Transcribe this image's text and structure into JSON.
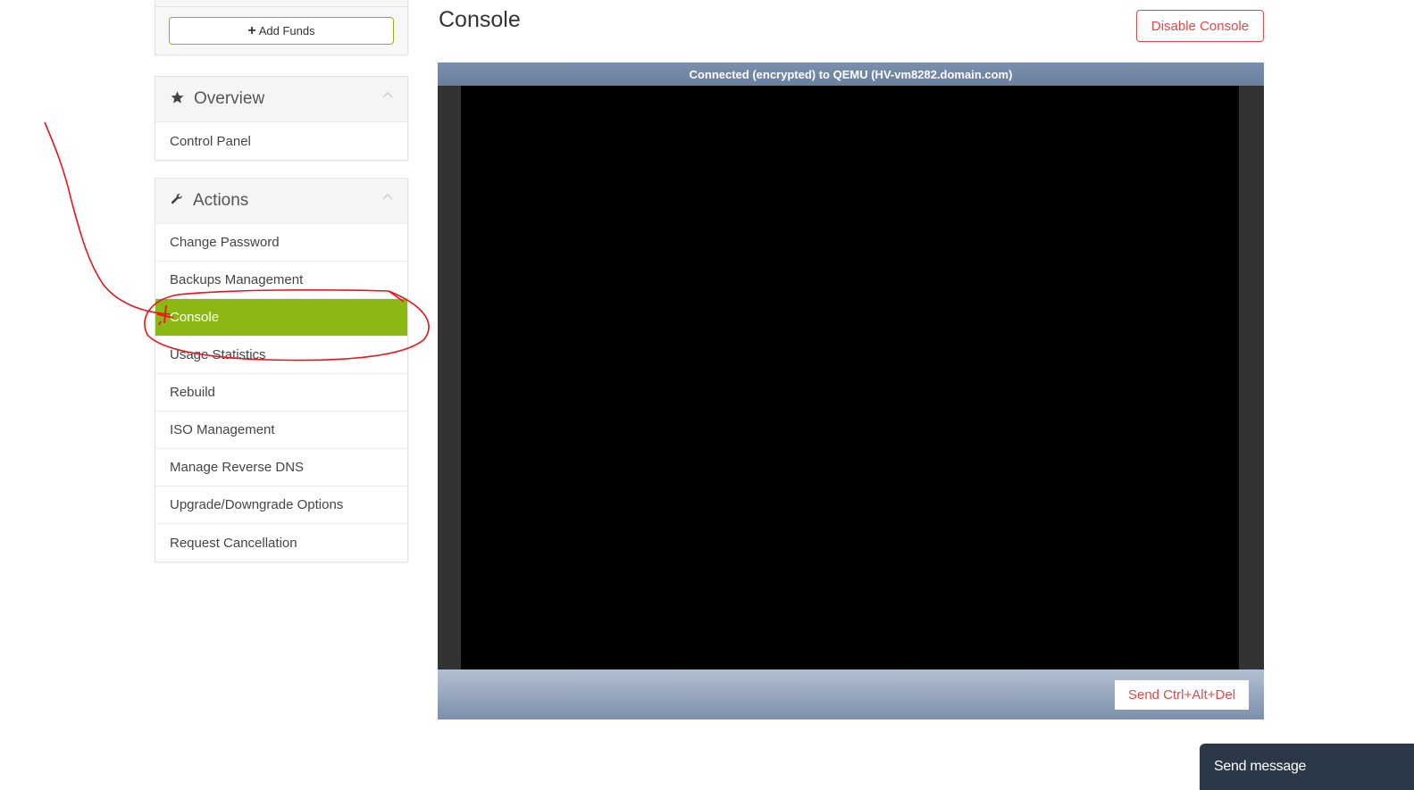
{
  "sidebar": {
    "add_funds_label": "Add Funds",
    "overview": {
      "title": "Overview",
      "items": [
        {
          "label": "Control Panel"
        }
      ]
    },
    "actions": {
      "title": "Actions",
      "items": [
        {
          "label": "Change Password"
        },
        {
          "label": "Backups Management"
        },
        {
          "label": "Console",
          "active": true
        },
        {
          "label": "Usage Statistics"
        },
        {
          "label": "Rebuild"
        },
        {
          "label": "ISO Management"
        },
        {
          "label": "Manage Reverse DNS"
        },
        {
          "label": "Upgrade/Downgrade Options"
        },
        {
          "label": "Request Cancellation"
        }
      ]
    }
  },
  "main": {
    "title": "Console",
    "disable_label": "Disable Console",
    "console": {
      "status": "Connected (encrypted) to QEMU (HV-vm8282.domain.com)",
      "ctrl_alt_del_label": "Send Ctrl+Alt+Del"
    }
  },
  "chat": {
    "label": "Send message"
  },
  "colors": {
    "accent_green": "#8cb813",
    "danger_red": "#e44848",
    "annotation_red": "#e8141a"
  },
  "icons": {
    "add_funds": "plus-icon",
    "overview": "star-icon",
    "actions": "wrench-icon",
    "collapse": "chevron-up-icon"
  }
}
